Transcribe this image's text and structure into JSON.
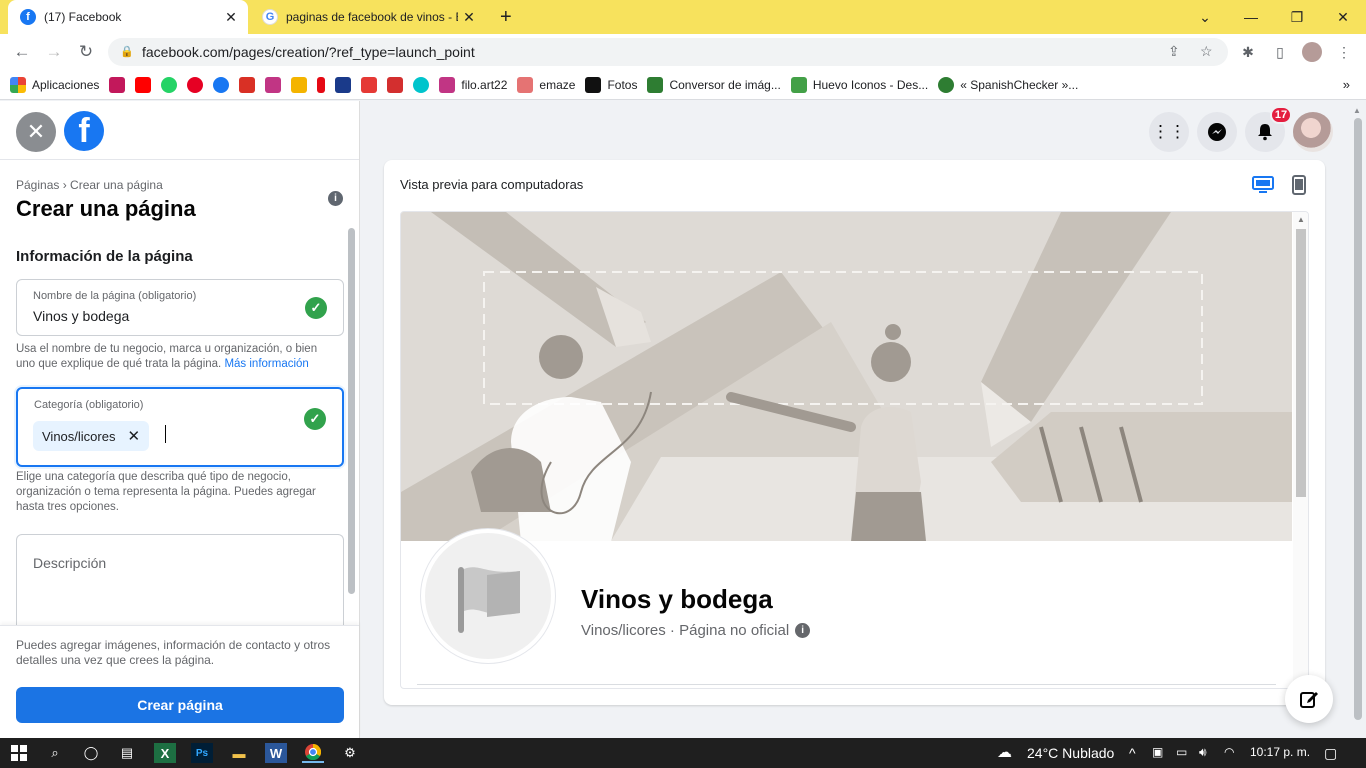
{
  "browser": {
    "tabs": [
      {
        "title": "(17) Facebook",
        "icon": "facebook-icon",
        "active": true
      },
      {
        "title": "paginas de facebook de vinos - E",
        "icon": "google-icon",
        "active": false
      }
    ],
    "url": "facebook.com/pages/creation/?ref_type=launch_point",
    "bookmarks": [
      {
        "label": "Aplicaciones",
        "icon": "apps-grid-icon",
        "color": "#ea4335"
      },
      {
        "label": "",
        "icon": "pinterest-ish-icon",
        "color": "#c2185b"
      },
      {
        "label": "",
        "icon": "youtube-icon",
        "color": "#ff0000"
      },
      {
        "label": "",
        "icon": "whatsapp-icon",
        "color": "#25d366"
      },
      {
        "label": "",
        "icon": "pinterest-icon",
        "color": "#e60023"
      },
      {
        "label": "",
        "icon": "facebook-icon",
        "color": "#1877f2"
      },
      {
        "label": "",
        "icon": "gmail-icon",
        "color": "#d93025"
      },
      {
        "label": "",
        "icon": "instagram-icon",
        "color": "#c13584"
      },
      {
        "label": "",
        "icon": "contact-card-icon",
        "color": "#f4b400"
      },
      {
        "label": "",
        "icon": "netflix-icon",
        "color": "#e50914"
      },
      {
        "label": "",
        "icon": "disney-icon",
        "color": "#1a3a8a"
      },
      {
        "label": "",
        "icon": "star-icon",
        "color": "#e53935"
      },
      {
        "label": "",
        "icon": "heart-icon",
        "color": "#d32f2f"
      },
      {
        "label": "",
        "icon": "canva-icon",
        "color": "#00c4cc"
      },
      {
        "label": "filo.art22",
        "icon": "instagram-icon",
        "color": "#c13584"
      },
      {
        "label": "emaze",
        "icon": "emaze-icon",
        "color": "#e57373"
      },
      {
        "label": "Fotos",
        "icon": "tiktok-icon",
        "color": "#111111"
      },
      {
        "label": "Conversor de imág...",
        "icon": "converter-icon",
        "color": "#2e7d32"
      },
      {
        "label": "Huevo Iconos - Des...",
        "icon": "icons-site-icon",
        "color": "#43a047"
      },
      {
        "label": "« SpanishChecker »...",
        "icon": "checker-icon",
        "color": "#2e7d32"
      }
    ]
  },
  "left": {
    "breadcrumb": "Páginas › Crear una página",
    "title": "Crear una página",
    "section_title": "Información de la página",
    "name_field": {
      "label": "Nombre de la página (obligatorio)",
      "value": "Vinos y bodega"
    },
    "name_help": "Usa el nombre de tu negocio, marca u organización, o bien uno que explique de qué trata la página.",
    "name_help_link": "Más información",
    "category_field": {
      "label": "Categoría (obligatorio)",
      "chip": "Vinos/licores"
    },
    "category_help": "Elige una categoría que describa qué tipo de negocio, organización o tema representa la página. Puedes agregar hasta tres opciones.",
    "description_placeholder": "Descripción",
    "footer_note": "Puedes agregar imágenes, información de contacto y otros detalles una vez que crees la página.",
    "create_button": "Crear página"
  },
  "right": {
    "notification_count": "17",
    "preview_title": "Vista previa para computadoras",
    "page_name": "Vinos y bodega",
    "page_subtitle": "Vinos/licores · Página no oficial"
  },
  "taskbar": {
    "weather": "24°C  Nublado",
    "time": "10:17 p. m."
  },
  "colors": {
    "facebook_blue": "#1877f2",
    "check_green": "#31a24c",
    "badge_red": "#e41e3f",
    "tabbar_yellow": "#f7e25d"
  }
}
